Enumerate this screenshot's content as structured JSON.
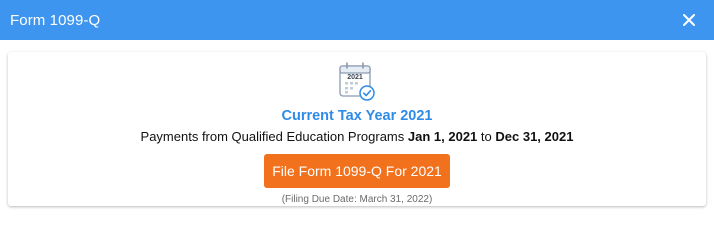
{
  "header": {
    "title": "Form 1099-Q",
    "close_icon": "close-icon",
    "background": "#3d95f0"
  },
  "main": {
    "icon": "calendar-check-icon",
    "calendar_year": "2021",
    "tax_year_title": "Current Tax Year 2021",
    "payments_text": "Payments from Qualified Education Programs",
    "start_date": "Jan 1, 2021",
    "to_word": "to",
    "end_date": "Dec 31, 2021",
    "file_button_label": "File Form 1099-Q For 2021",
    "due_date_note": "(Filing Due Date: March 31, 2022)"
  },
  "colors": {
    "accent": "#2f8be8",
    "button": "#f2711c"
  }
}
